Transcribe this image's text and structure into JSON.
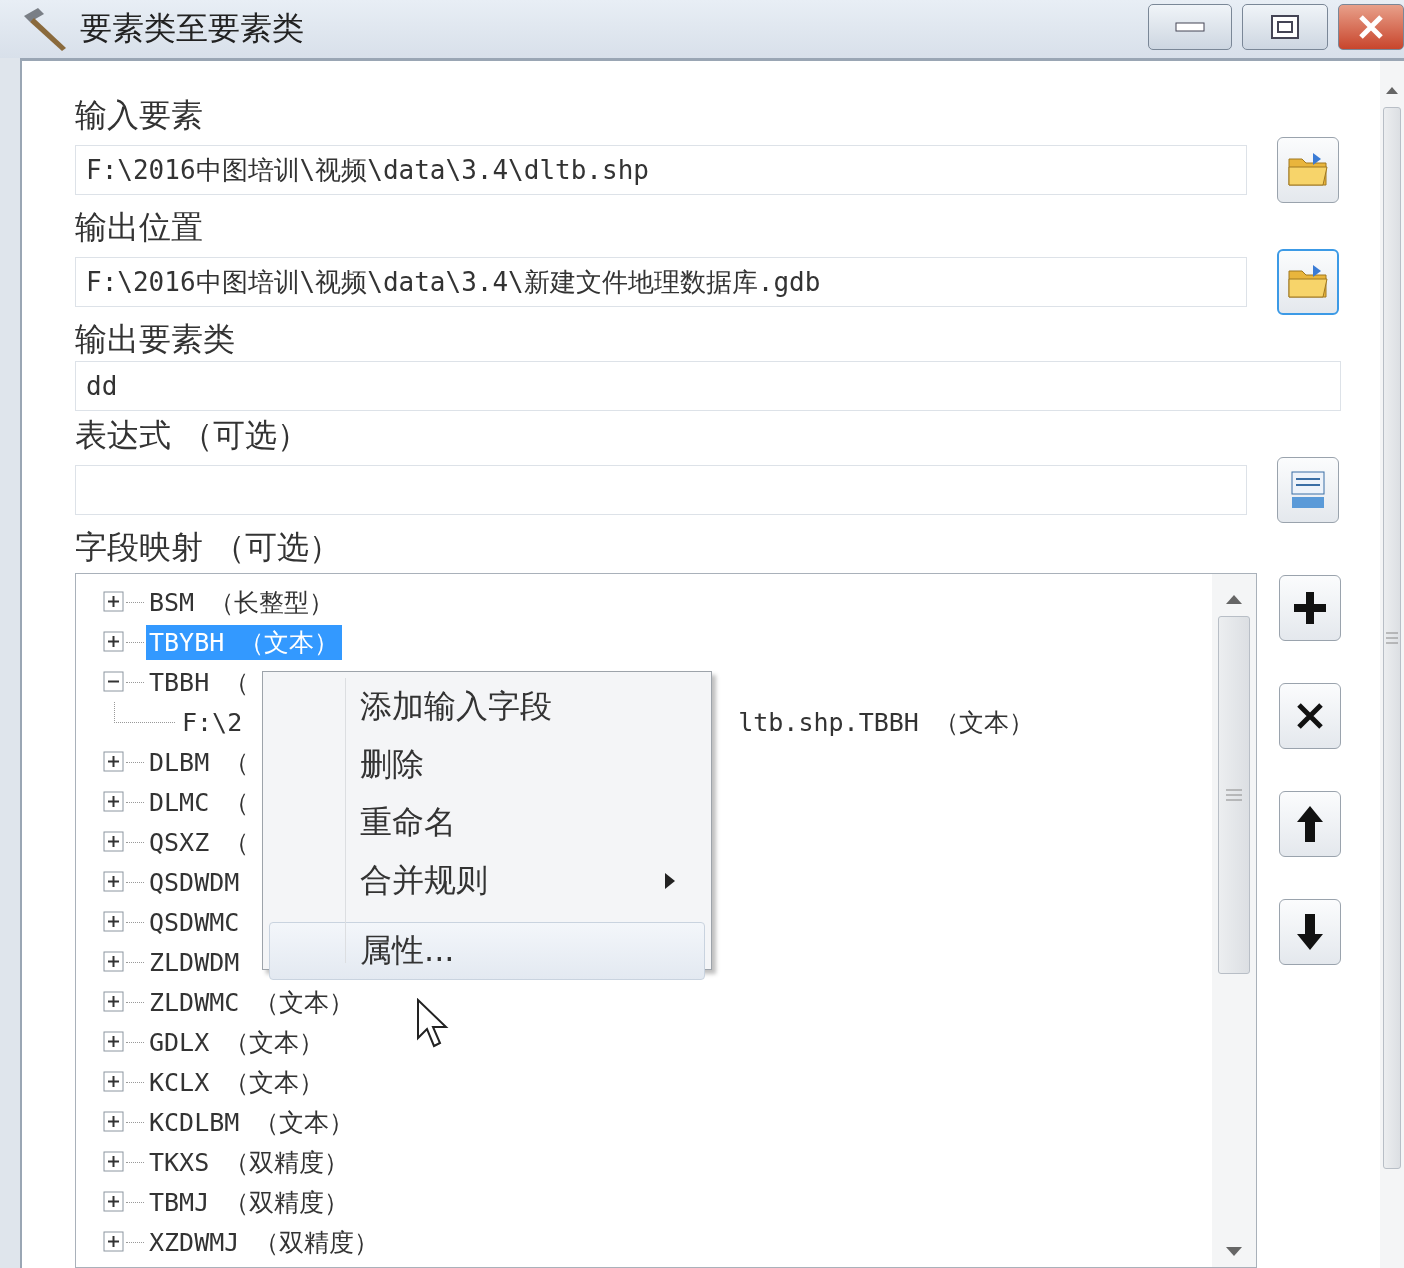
{
  "window": {
    "title": "要素类至要素类"
  },
  "fields": [
    {
      "label": "输入要素",
      "value": "F:\\2016中图培训\\视频\\data\\3.4\\dltb.shp",
      "button": {
        "kind": "folder",
        "focused": false
      }
    },
    {
      "label": "输出位置",
      "value": "F:\\2016中图培训\\视频\\data\\3.4\\新建文件地理数据库.gdb",
      "button": {
        "kind": "folder",
        "focused": true
      }
    },
    {
      "label": "输出要素类",
      "value": "dd"
    },
    {
      "label": "表达式 （可选）",
      "button": {
        "kind": "sql",
        "focused": false
      }
    }
  ],
  "field_map": {
    "label": "字段映射 （可选）",
    "nodes": [
      {
        "label": "BSM （长整型）",
        "expanded": false,
        "selected": false
      },
      {
        "label": "TBYBH （文本）",
        "expanded": false,
        "selected": true
      },
      {
        "label": "TBBH （",
        "expanded": true,
        "selected": false,
        "children": [
          {
            "label": "F:\\2",
            "tail": "ltb.shp.TBBH （文本）"
          }
        ]
      },
      {
        "label": "DLBM （",
        "expanded": false,
        "selected": false
      },
      {
        "label": "DLMC （",
        "expanded": false,
        "selected": false
      },
      {
        "label": "QSXZ （",
        "expanded": false,
        "selected": false
      },
      {
        "label": "QSDWDM",
        "expanded": false,
        "selected": false
      },
      {
        "label": "QSDWMC",
        "expanded": false,
        "selected": false
      },
      {
        "label": "ZLDWDM",
        "expanded": false,
        "selected": false
      },
      {
        "label": "ZLDWMC （文本）",
        "expanded": false,
        "selected": false
      },
      {
        "label": "GDLX （文本）",
        "expanded": false,
        "selected": false
      },
      {
        "label": "KCLX （文本）",
        "expanded": false,
        "selected": false
      },
      {
        "label": "KCDLBM （文本）",
        "expanded": false,
        "selected": false
      },
      {
        "label": "TKXS （双精度）",
        "expanded": false,
        "selected": false
      },
      {
        "label": "TBMJ （双精度）",
        "expanded": false,
        "selected": false
      },
      {
        "label": "XZDWMJ （双精度）",
        "expanded": false,
        "selected": false
      }
    ],
    "tool_buttons": [
      {
        "kind": "add"
      },
      {
        "kind": "delete"
      },
      {
        "kind": "up"
      },
      {
        "kind": "down"
      }
    ]
  },
  "context_menu": {
    "items": [
      {
        "label": "添加输入字段",
        "submenu": false,
        "highlighted": false
      },
      {
        "label": "删除",
        "submenu": false,
        "highlighted": false
      },
      {
        "label": "重命名",
        "submenu": false,
        "highlighted": false
      },
      {
        "label": "合并规则",
        "submenu": true,
        "highlighted": false
      },
      {
        "label": "属性...",
        "submenu": false,
        "highlighted": true,
        "separator_before": true
      }
    ]
  }
}
